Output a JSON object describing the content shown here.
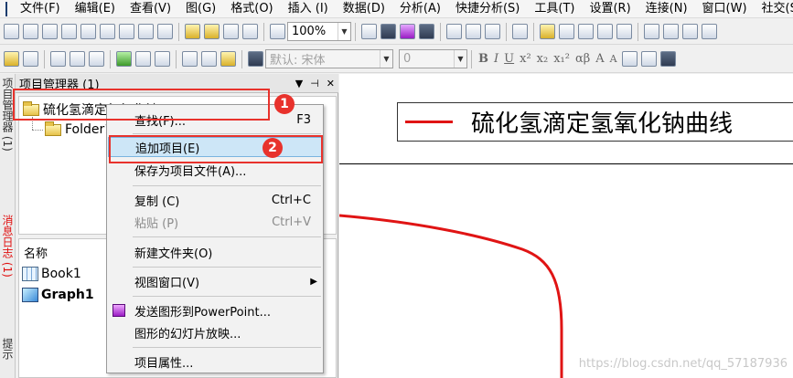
{
  "menubar": {
    "items": [
      "文件(F)",
      "编辑(E)",
      "查看(V)",
      "图(G)",
      "格式(O)",
      "插入 (I)",
      "数据(D)",
      "分析(A)",
      "快捷分析(S)",
      "工具(T)",
      "设置(R)",
      "连接(N)",
      "窗口(W)",
      "社交(S"
    ]
  },
  "toolbar1": {
    "zoom_value": "100%"
  },
  "toolbar2": {
    "font_value": "默认: 宋体",
    "size_value": "0",
    "format_labels": [
      "B",
      "I",
      "U",
      "x²",
      "x₂",
      "x₁²",
      "αβ",
      "A",
      "A"
    ]
  },
  "side_tabs": {
    "tab1": "项目管理器 (1)",
    "tab2": "消息日志 (1)",
    "tab3": "提示"
  },
  "project_manager": {
    "title": "项目管理器 (1)",
    "controls": [
      "▼",
      "⊣",
      "✕"
    ],
    "tree_root": "硫化氢滴定氢氧化钠",
    "tree_folder": "Folder1",
    "list_header": "名称",
    "list_items": [
      "Book1",
      "Graph1"
    ]
  },
  "graph": {
    "legend_text": "硫化氢滴定氢氧化钠曲线",
    "watermark": "https://blog.csdn.net/qq_57187936",
    "line_color": "#e01414"
  },
  "context_menu": {
    "items": [
      {
        "label": "查找(F)...",
        "shortcut": "F3"
      },
      {
        "label": "追加项目(E)",
        "shortcut": ""
      },
      {
        "label": "保存为项目文件(A)...",
        "shortcut": ""
      },
      {
        "label": "复制 (C)",
        "shortcut": "Ctrl+C"
      },
      {
        "label": "粘贴 (P)",
        "shortcut": "Ctrl+V"
      },
      {
        "label": "新建文件夹(O)",
        "shortcut": ""
      },
      {
        "label": "视图窗口(V)",
        "shortcut": ""
      },
      {
        "label": "发送图形到PowerPoint...",
        "shortcut": ""
      },
      {
        "label": "图形的幻灯片放映...",
        "shortcut": ""
      },
      {
        "label": "项目属性...",
        "shortcut": ""
      }
    ]
  },
  "annotations": {
    "badge1": "1",
    "badge2": "2",
    "color": "#e8322c"
  }
}
